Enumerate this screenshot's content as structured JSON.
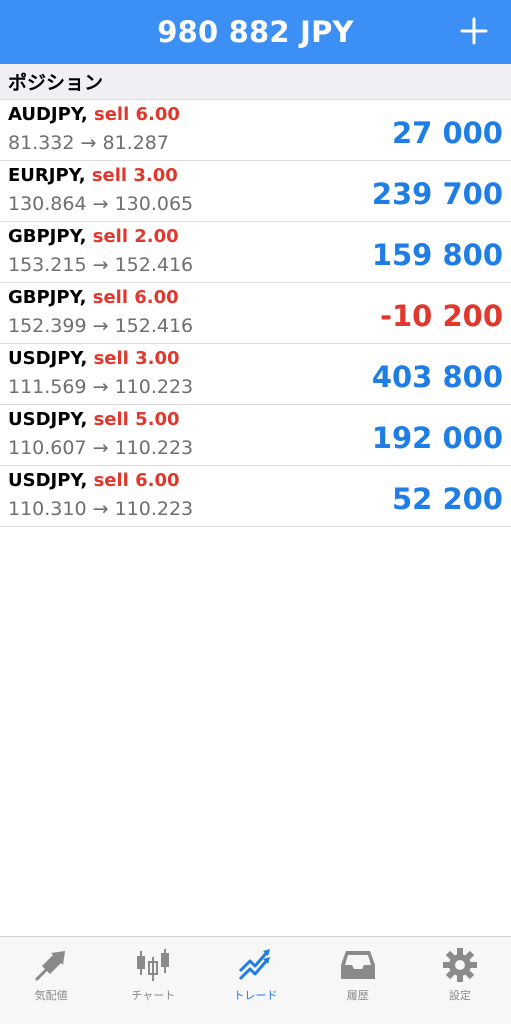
{
  "header": {
    "title": "980 882 JPY",
    "add_icon": "plus-icon"
  },
  "section": {
    "title": "ポジション"
  },
  "positions": [
    {
      "symbol": "AUDJPY,",
      "side": "sell 6.00",
      "prices": "81.332 → 81.287",
      "profit": "27 000",
      "negative": false
    },
    {
      "symbol": "EURJPY,",
      "side": "sell 3.00",
      "prices": "130.864 → 130.065",
      "profit": "239 700",
      "negative": false
    },
    {
      "symbol": "GBPJPY,",
      "side": "sell 2.00",
      "prices": "153.215 → 152.416",
      "profit": "159 800",
      "negative": false
    },
    {
      "symbol": "GBPJPY,",
      "side": "sell 6.00",
      "prices": "152.399 → 152.416",
      "profit": "-10 200",
      "negative": true
    },
    {
      "symbol": "USDJPY,",
      "side": "sell 3.00",
      "prices": "111.569 → 110.223",
      "profit": "403 800",
      "negative": false
    },
    {
      "symbol": "USDJPY,",
      "side": "sell 5.00",
      "prices": "110.607 → 110.223",
      "profit": "192 000",
      "negative": false
    },
    {
      "symbol": "USDJPY,",
      "side": "sell 6.00",
      "prices": "110.310 → 110.223",
      "profit": "52 200",
      "negative": false
    }
  ],
  "tabs": [
    {
      "label": "気配値",
      "icon": "quotes-arrows-icon",
      "active": false
    },
    {
      "label": "チャート",
      "icon": "candlestick-chart-icon",
      "active": false
    },
    {
      "label": "トレード",
      "icon": "trade-trend-icon",
      "active": true
    },
    {
      "label": "履歴",
      "icon": "history-tray-icon",
      "active": false
    },
    {
      "label": "設定",
      "icon": "settings-gear-icon",
      "active": false
    }
  ],
  "colors": {
    "header_bg": "#3b8ff5",
    "profit_positive": "#1f7de6",
    "profit_negative": "#e2372c",
    "sell_label": "#e2372c",
    "tab_active": "#1f7de6",
    "tab_inactive": "#8a8a8a"
  }
}
